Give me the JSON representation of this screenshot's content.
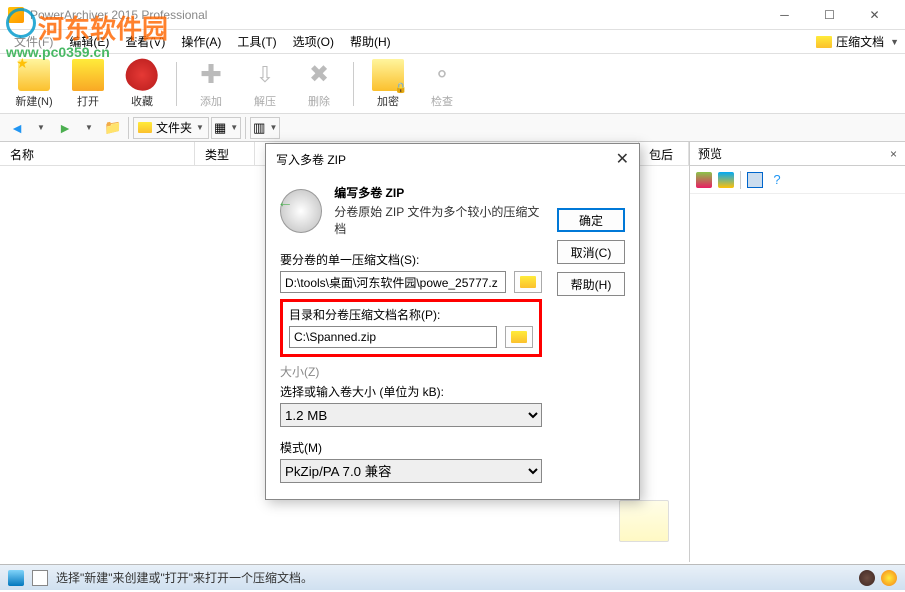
{
  "titlebar": {
    "title": "PowerArchiver 2015 Professional"
  },
  "menu": {
    "file": "文件(F)",
    "edit": "编辑(E)",
    "view": "查看(V)",
    "action": "操作(A)",
    "tools": "工具(T)",
    "options": "选项(O)",
    "help": "帮助(H)",
    "compress_doc": "压缩文档"
  },
  "toolbar": {
    "new": "新建(N)",
    "open": "打开",
    "fav": "收藏",
    "add": "添加",
    "extract": "解压",
    "delete": "删除",
    "encrypt": "加密",
    "check": "检查"
  },
  "nav": {
    "folders": "文件夹"
  },
  "listhdr": {
    "name": "名称",
    "type": "类型",
    "after": "包后"
  },
  "preview": {
    "title": "预览"
  },
  "dialog": {
    "title": "写入多卷 ZIP",
    "heading": "编写多卷 ZIP",
    "subheading": "分卷原始 ZIP 文件为多个较小的压缩文档",
    "label_source": "要分卷的单一压缩文档(S):",
    "value_source": "D:\\tools\\桌面\\河东软件园\\powe_25777.z",
    "label_target": "目录和分卷压缩文档名称(P):",
    "value_target": "C:\\Spanned.zip",
    "label_size_hdr": "大小(Z)",
    "label_size": "选择或输入卷大小 (单位为 kB):",
    "value_size": "1.2 MB",
    "label_mode": "模式(M)",
    "value_mode": "PkZip/PA 7.0 兼容",
    "btn_ok": "确定",
    "btn_cancel": "取消(C)",
    "btn_help": "帮助(H)"
  },
  "status": {
    "text": "选择\"新建\"来创建或\"打开\"来打开一个压缩文档。"
  },
  "watermark": {
    "text": "河东软件园",
    "url": "www.pc0359.cn"
  }
}
